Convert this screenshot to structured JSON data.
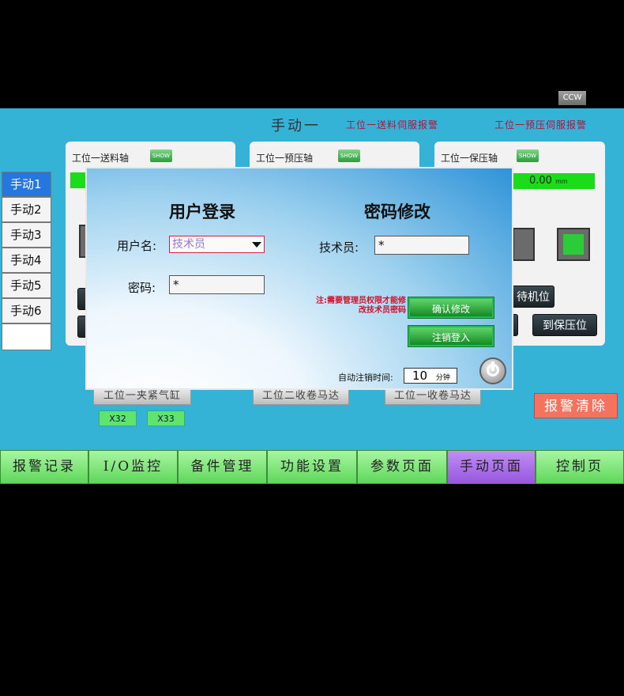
{
  "header": {
    "title": "手动一",
    "alarm_feed_servo": "工位一送料伺服报警",
    "alarm_prepress_servo": "工位一预压伺服报警"
  },
  "panels": [
    {
      "title": "工位一送料轴",
      "show": "SHOW"
    },
    {
      "title": "工位一预压轴",
      "show": "SHOW"
    },
    {
      "title": "工位一保压轴",
      "show": "SHOW",
      "readout": "0.00",
      "unit": "mm",
      "ccw": "CCW"
    }
  ],
  "side_tabs": [
    "手动1",
    "手动2",
    "手动3",
    "手动4",
    "手动5",
    "手动6"
  ],
  "right_buttons": {
    "wait": "待机位",
    "to_hold": "到保压位"
  },
  "bg_buttons": {
    "clamp": "工位一夹紧气缸",
    "winder2": "工位二收卷马达",
    "winder1": "工位一收卷马达",
    "x32": "X32",
    "x33": "X33"
  },
  "alarm_clear": "报警清除",
  "bottom_nav": [
    "报警记录",
    "I/O监控",
    "备件管理",
    "功能设置",
    "参数页面",
    "手动页面",
    "控制页"
  ],
  "dialog": {
    "login_title": "用户登录",
    "change_title": "密码修改",
    "username_label": "用户名:",
    "username_value": "技术员",
    "password_label": "密码:",
    "password_value": "*",
    "tech_label": "技术员:",
    "tech_value": "*",
    "note": "注:需要管理员权限才能修改技术员密码",
    "confirm_button": "确认修改",
    "logout_button": "注销登入",
    "auto_logout_label": "自动注销时间:",
    "auto_logout_value": "10",
    "auto_logout_unit": "分钟"
  }
}
